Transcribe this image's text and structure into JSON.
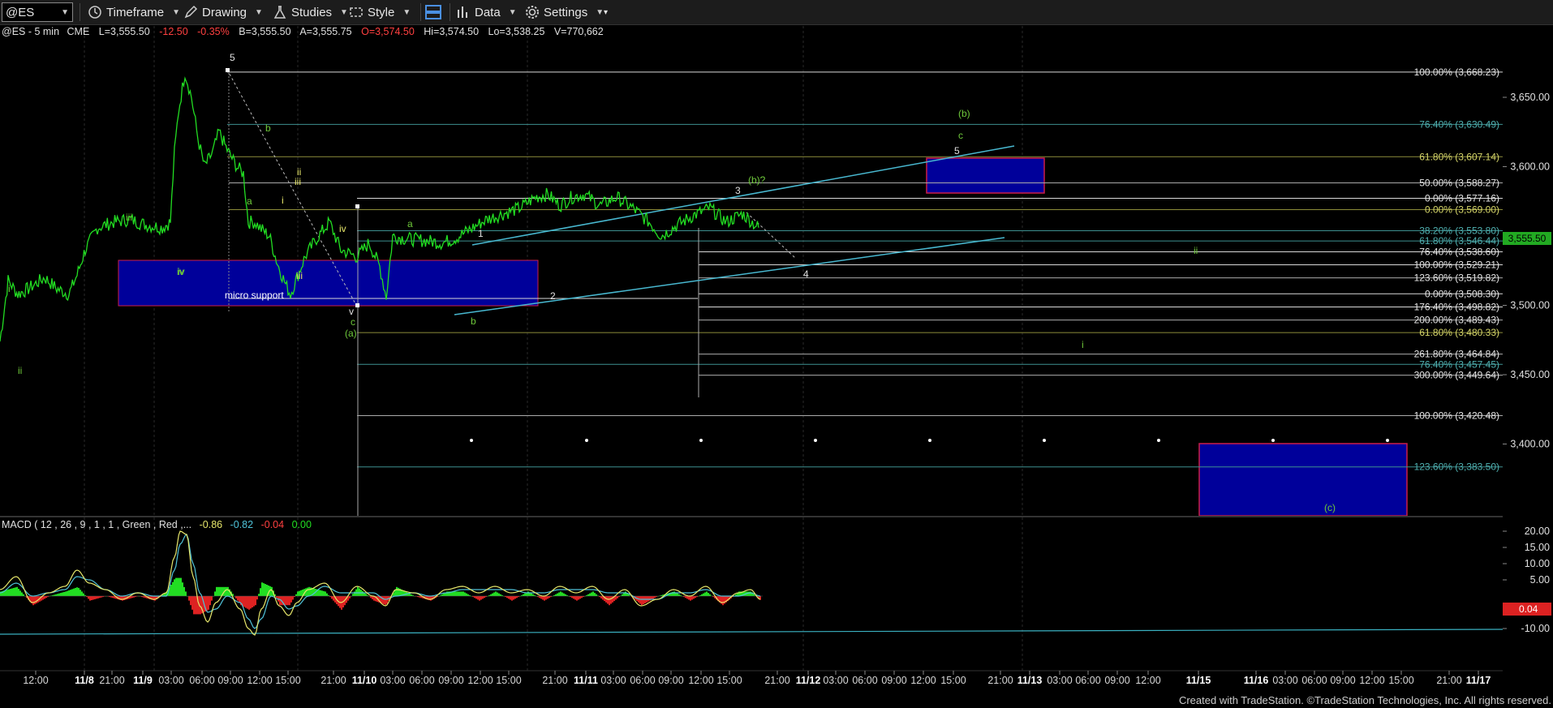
{
  "toolbar": {
    "symbol": "@ES",
    "timeframe": "Timeframe",
    "drawing": "Drawing",
    "studies": "Studies",
    "style": "Style",
    "data": "Data",
    "settings": "Settings"
  },
  "header": {
    "symbol_interval": "@ES - 5 min",
    "exchange": "CME",
    "last": "L=3,555.50",
    "change": "-12.50",
    "change_pct": "-0.35%",
    "bid": "B=3,555.50",
    "ask": "A=3,555.75",
    "open": "O=3,574.50",
    "high": "Hi=3,574.50",
    "low": "Lo=3,538.25",
    "volume": "V=770,662"
  },
  "macd_header": {
    "params": "MACD ( 12 , 26 , 9 , 1 , 1 , Green , Red ,...",
    "macd": "-0.86",
    "signal": "-0.82",
    "hist": "-0.04",
    "zero": "0.00"
  },
  "colors": {
    "price": "#22dd22",
    "box": "#00009a",
    "box_border": "#cc1e4a",
    "fib_white": "#d8d8d8",
    "fib_teal": "#3d8f8f",
    "fib_olive": "#8c8c3a",
    "channel": "#48b8d0",
    "wave_green": "#6ec83a",
    "wave_yellow": "#e6e66a",
    "macd_line": "#e6e66a",
    "signal_line": "#4fc3d9",
    "hist_pos": "#22dd22",
    "hist_neg": "#dd2222"
  },
  "chart_data": {
    "type": "line",
    "title": "@ES - 5 min",
    "ylim": [
      3370,
      3690
    ],
    "y_ticks": [
      "3,650.00",
      "3,600.00",
      "3,550.00",
      "3,500.00",
      "3,450.00",
      "3,400.00"
    ],
    "x_ticks": [
      "12:00",
      "11/8",
      "21:00",
      "11/9",
      "03:00",
      "06:00",
      "09:00",
      "12:00",
      "15:00",
      "21:00",
      "11/10",
      "03:00",
      "06:00",
      "09:00",
      "12:00",
      "15:00",
      "21:00",
      "11/11",
      "03:00",
      "06:00",
      "09:00",
      "12:00",
      "15:00",
      "21:00",
      "11/12",
      "03:00",
      "06:00",
      "09:00",
      "12:00",
      "15:00",
      "21:00",
      "11/13",
      "03:00",
      "06:00",
      "09:00",
      "12:00",
      "11/15",
      "11/16",
      "03:00",
      "06:00",
      "09:00",
      "12:00",
      "15:00",
      "21:00",
      "11/17"
    ],
    "last_price": "3,555.50",
    "series": [
      {
        "name": "@ES",
        "points": [
          [
            0,
            3474
          ],
          [
            10,
            3518
          ],
          [
            22,
            3508
          ],
          [
            35,
            3512
          ],
          [
            55,
            3520
          ],
          [
            70,
            3512
          ],
          [
            85,
            3508
          ],
          [
            95,
            3522
          ],
          [
            105,
            3540
          ],
          [
            120,
            3556
          ],
          [
            140,
            3560
          ],
          [
            160,
            3562
          ],
          [
            180,
            3558
          ],
          [
            200,
            3556
          ],
          [
            210,
            3560
          ],
          [
            215,
            3610
          ],
          [
            220,
            3640
          ],
          [
            228,
            3668
          ],
          [
            236,
            3650
          ],
          [
            244,
            3620
          ],
          [
            252,
            3600
          ],
          [
            262,
            3610
          ],
          [
            270,
            3625
          ],
          [
            280,
            3612
          ],
          [
            292,
            3600
          ],
          [
            300,
            3595
          ],
          [
            306,
            3560
          ],
          [
            314,
            3560
          ],
          [
            322,
            3555
          ],
          [
            332,
            3550
          ],
          [
            342,
            3530
          ],
          [
            352,
            3515
          ],
          [
            358,
            3508
          ],
          [
            366,
            3520
          ],
          [
            376,
            3535
          ],
          [
            390,
            3548
          ],
          [
            406,
            3560
          ],
          [
            420,
            3540
          ],
          [
            440,
            3535
          ],
          [
            455,
            3545
          ],
          [
            468,
            3528
          ],
          [
            476,
            3506
          ],
          [
            484,
            3550
          ],
          [
            500,
            3548
          ],
          [
            520,
            3547
          ],
          [
            545,
            3545
          ],
          [
            560,
            3548
          ],
          [
            580,
            3555
          ],
          [
            600,
            3562
          ],
          [
            620,
            3566
          ],
          [
            640,
            3570
          ],
          [
            660,
            3578
          ],
          [
            675,
            3580
          ],
          [
            690,
            3572
          ],
          [
            705,
            3578
          ],
          [
            720,
            3580
          ],
          [
            740,
            3572
          ],
          [
            760,
            3578
          ],
          [
            780,
            3570
          ],
          [
            800,
            3560
          ],
          [
            815,
            3550
          ],
          [
            835,
            3558
          ],
          [
            855,
            3565
          ],
          [
            875,
            3570
          ],
          [
            895,
            3560
          ],
          [
            915,
            3566
          ],
          [
            935,
            3556
          ]
        ]
      }
    ],
    "fib_levels": [
      {
        "label": "100.00% (3,668.23)",
        "value": 3668.23
      },
      {
        "label": "76.40% (3,630.49)",
        "value": 3630.49
      },
      {
        "label": "61.80% (3,607.14)",
        "value": 3607.14
      },
      {
        "label": "50.00% (3,588.27)",
        "value": 3588.27
      },
      {
        "label": "0.00% (3,577.16)",
        "value": 3577.16
      },
      {
        "label": "0.00% (3,569.00)",
        "value": 3569.0
      },
      {
        "label": "38.20% (3,553.80)",
        "value": 3553.8
      },
      {
        "label": "61.80% (3,546.44)",
        "value": 3546.44
      },
      {
        "label": "76.40% (3,538.60)",
        "value": 3538.6
      },
      {
        "label": "100.00% (3,529.21)",
        "value": 3529.21
      },
      {
        "label": "123.60% (3,519.82)",
        "value": 3519.82
      },
      {
        "label": "0.00% (3,508.30)",
        "value": 3508.3
      },
      {
        "label": "176.40% (3,498.82)",
        "value": 3498.82
      },
      {
        "label": "200.00% (3,489.43)",
        "value": 3489.43
      },
      {
        "label": "61.80% (3,480.33)",
        "value": 3480.33
      },
      {
        "label": "261.80% (3,464.84)",
        "value": 3464.84
      },
      {
        "label": "76.40% (3,457.45)",
        "value": 3457.45
      },
      {
        "label": "300.00% (3,449.64)",
        "value": 3449.64
      },
      {
        "label": "100.00% (3,420.48)",
        "value": 3420.48
      },
      {
        "label": "123.60% (3,383.50)",
        "value": 3383.5
      }
    ],
    "annotations": [
      "5",
      "b",
      "ii",
      "iii",
      "a",
      "i",
      "iv",
      "micro support",
      "iii",
      "iv",
      "a",
      "v",
      "c",
      "(a)",
      "1",
      "b",
      "2",
      "3",
      "(b)?",
      "4",
      "(b)",
      "c",
      "5",
      "ii",
      "i",
      "(c)",
      "i",
      "ii",
      "iii",
      "iv"
    ]
  },
  "macd": {
    "ylim": [
      -13,
      22
    ],
    "y_ticks": [
      "20.00",
      "15.00",
      "10.00",
      "5.00",
      "-5.00",
      "-10.00"
    ],
    "current_hist": "0.04",
    "macd_line": [
      [
        0,
        2
      ],
      [
        20,
        6
      ],
      [
        40,
        -2
      ],
      [
        60,
        1
      ],
      [
        80,
        3
      ],
      [
        95,
        8
      ],
      [
        110,
        4
      ],
      [
        130,
        2
      ],
      [
        150,
        -1
      ],
      [
        170,
        1
      ],
      [
        190,
        -1
      ],
      [
        205,
        1
      ],
      [
        215,
        12
      ],
      [
        222,
        20
      ],
      [
        230,
        19
      ],
      [
        238,
        6
      ],
      [
        246,
        -3
      ],
      [
        256,
        -8
      ],
      [
        266,
        -2
      ],
      [
        280,
        2
      ],
      [
        296,
        -4
      ],
      [
        306,
        -10
      ],
      [
        314,
        -12
      ],
      [
        322,
        -4
      ],
      [
        334,
        2
      ],
      [
        344,
        -3
      ],
      [
        356,
        -6
      ],
      [
        366,
        -2
      ],
      [
        380,
        2
      ],
      [
        400,
        4
      ],
      [
        420,
        -2
      ],
      [
        440,
        3
      ],
      [
        460,
        0
      ],
      [
        475,
        -3
      ],
      [
        488,
        2
      ],
      [
        510,
        1
      ],
      [
        530,
        -1
      ],
      [
        550,
        2
      ],
      [
        570,
        3
      ],
      [
        590,
        1
      ],
      [
        610,
        3
      ],
      [
        630,
        1
      ],
      [
        650,
        2
      ],
      [
        670,
        0
      ],
      [
        690,
        3
      ],
      [
        710,
        1
      ],
      [
        730,
        3
      ],
      [
        750,
        -1
      ],
      [
        770,
        2
      ],
      [
        790,
        -3
      ],
      [
        810,
        -1
      ],
      [
        830,
        2
      ],
      [
        850,
        0
      ],
      [
        870,
        3
      ],
      [
        890,
        -2
      ],
      [
        910,
        1
      ],
      [
        925,
        2
      ],
      [
        937,
        -1
      ]
    ],
    "signal_line": [
      [
        0,
        1
      ],
      [
        20,
        4
      ],
      [
        40,
        0
      ],
      [
        60,
        1
      ],
      [
        80,
        2
      ],
      [
        95,
        6
      ],
      [
        110,
        5
      ],
      [
        130,
        2
      ],
      [
        150,
        0
      ],
      [
        170,
        1
      ],
      [
        190,
        0
      ],
      [
        205,
        0
      ],
      [
        215,
        8
      ],
      [
        222,
        16
      ],
      [
        230,
        19
      ],
      [
        238,
        10
      ],
      [
        246,
        1
      ],
      [
        256,
        -5
      ],
      [
        266,
        -4
      ],
      [
        280,
        0
      ],
      [
        296,
        -2
      ],
      [
        306,
        -7
      ],
      [
        314,
        -10
      ],
      [
        322,
        -7
      ],
      [
        334,
        0
      ],
      [
        344,
        -1
      ],
      [
        356,
        -4
      ],
      [
        366,
        -3
      ],
      [
        380,
        0
      ],
      [
        400,
        3
      ],
      [
        420,
        1
      ],
      [
        440,
        1
      ],
      [
        460,
        1
      ],
      [
        475,
        -1
      ],
      [
        488,
        0
      ],
      [
        510,
        1
      ],
      [
        530,
        0
      ],
      [
        550,
        1
      ],
      [
        570,
        2
      ],
      [
        590,
        2
      ],
      [
        610,
        2
      ],
      [
        630,
        2
      ],
      [
        650,
        1
      ],
      [
        670,
        1
      ],
      [
        690,
        2
      ],
      [
        710,
        2
      ],
      [
        730,
        2
      ],
      [
        750,
        1
      ],
      [
        770,
        1
      ],
      [
        790,
        -1
      ],
      [
        810,
        -1
      ],
      [
        830,
        1
      ],
      [
        850,
        1
      ],
      [
        870,
        2
      ],
      [
        890,
        0
      ],
      [
        910,
        0
      ],
      [
        925,
        1
      ],
      [
        937,
        0
      ]
    ]
  },
  "footer": {
    "credit": "Created with TradeStation. ©TradeStation Technologies, Inc. All rights reserved."
  }
}
